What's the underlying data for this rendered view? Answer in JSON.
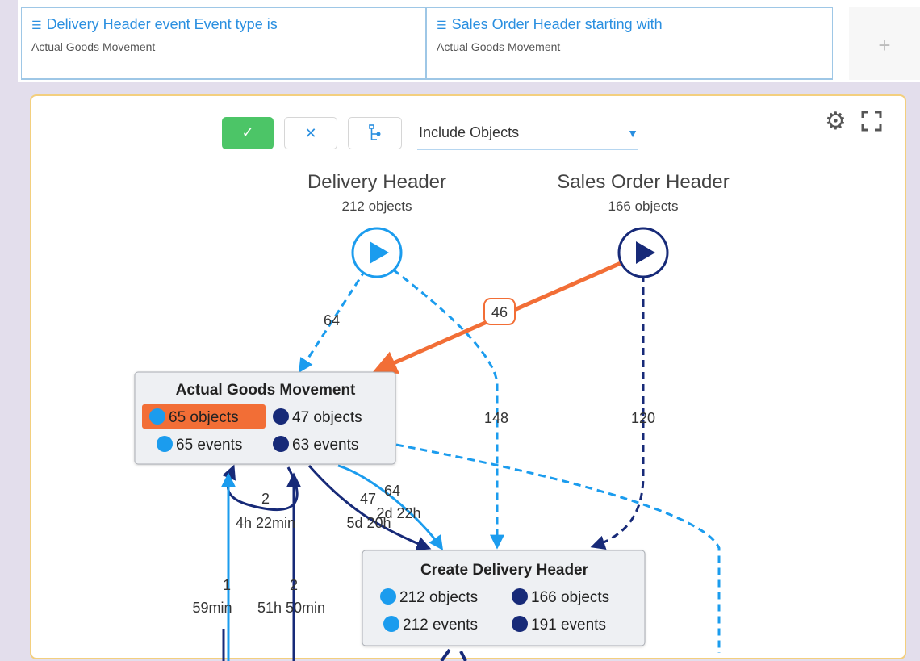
{
  "filters": [
    {
      "icon": "filter-icon",
      "title": "Delivery Header event Event type is",
      "subtitle": "Actual Goods Movement"
    },
    {
      "icon": "filter-icon",
      "title": "Sales Order Header starting with",
      "subtitle": "Actual Goods Movement"
    }
  ],
  "add_filter": {
    "icon": "plus-icon",
    "label": "+"
  },
  "toolbar": {
    "confirm_label": "✓",
    "cancel_label": "✕",
    "layout_icon": "hierarchy-icon",
    "dropdown_value": "Include Objects",
    "dropdown_caret": "▼",
    "settings_icon": "gear-icon",
    "fullscreen_icon": "fullscreen-icon"
  },
  "colors": {
    "delivery": "#1b9cee",
    "sales": "#172a78",
    "highlight": "#f26e36",
    "panel_border": "#f3cf7e"
  },
  "sources": {
    "delivery": {
      "title": "Delivery Header",
      "count": "212 objects",
      "icon": "play-icon"
    },
    "sales": {
      "title": "Sales Order Header",
      "count": "166 objects",
      "icon": "play-icon"
    }
  },
  "nodes": {
    "agm": {
      "title": "Actual Goods Movement",
      "delivery_objects": "65 objects",
      "sales_objects": "47 objects",
      "delivery_events": "65 events",
      "sales_events": "63 events"
    },
    "cdh": {
      "title": "Create Delivery Header",
      "delivery_objects": "212 objects",
      "sales_objects": "166 objects",
      "delivery_events": "212 events",
      "sales_events": "191 events"
    }
  },
  "edges": {
    "delivery_to_agm": "64",
    "sales_to_agm": "46",
    "delivery_to_cdh": "148",
    "sales_to_cdh": "120",
    "agm_loop_count": "2",
    "agm_loop_time": "4h 22min",
    "agm_to_cdh_sales_count": "47",
    "agm_to_cdh_sales_time": "5d 20h",
    "agm_to_cdh_delivery_count": "64",
    "agm_to_cdh_delivery_time": "2d 22h",
    "left_delivery_count": "1",
    "left_delivery_time": "59min",
    "left_sales_count": "2",
    "left_sales_time": "51h 50min"
  }
}
